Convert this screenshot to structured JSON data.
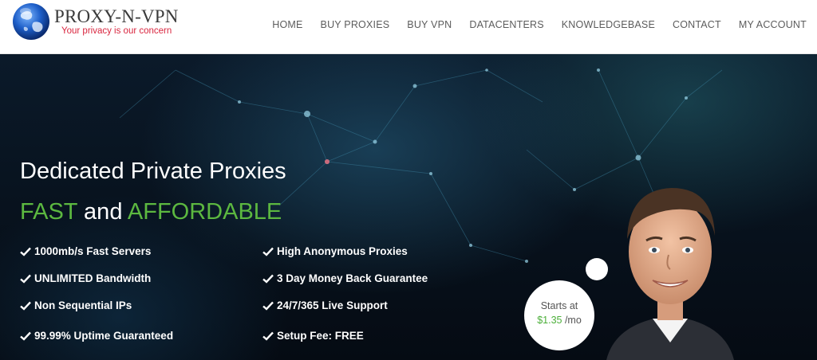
{
  "header": {
    "brand": "PROXY-N-VPN",
    "tagline": "Your privacy is our concern",
    "nav": [
      {
        "label": "HOME"
      },
      {
        "label": "BUY PROXIES"
      },
      {
        "label": "BUY VPN"
      },
      {
        "label": "DATACENTERS"
      },
      {
        "label": "KNOWLEDGEBASE"
      },
      {
        "label": "CONTACT"
      },
      {
        "label": "MY ACCOUNT"
      }
    ]
  },
  "hero": {
    "title": "Dedicated Private Proxies",
    "subtitle": {
      "word1": "FAST",
      "word2": " and ",
      "word3": "AFFORDABLE"
    },
    "features_left": [
      "1000mb/s Fast Servers",
      "UNLIMITED Bandwidth",
      "Non Sequential IPs",
      "99.99% Uptime Guaranteed"
    ],
    "features_right": [
      "High Anonymous Proxies",
      "3 Day Money Back Guarantee",
      "24/7/365 Live Support",
      "Setup Fee: FREE"
    ],
    "price_badge": {
      "starts": "Starts at",
      "price": "$1.35",
      "unit": " /mo"
    }
  },
  "icons": {
    "check": "check-icon",
    "globe": "globe-logo-icon"
  },
  "colors": {
    "accent_green": "#5cb840",
    "tagline_red": "#d9263f",
    "hero_bg": "#08131f"
  }
}
